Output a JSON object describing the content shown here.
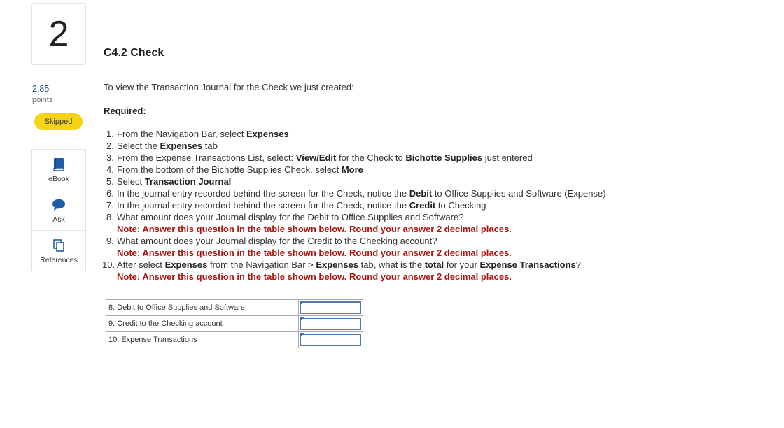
{
  "question_number": "2",
  "points": {
    "value": "2.85",
    "label": "points"
  },
  "status": "Skipped",
  "tools": [
    {
      "label": "eBook",
      "icon": "book-icon"
    },
    {
      "label": "Ask",
      "icon": "chat-bubble-icon"
    },
    {
      "label": "References",
      "icon": "copy-icon"
    }
  ],
  "title": "C4.2 Check",
  "intro": "To view the Transaction Journal for the Check we just created:",
  "required": "Required:",
  "steps": {
    "s1": {
      "n": "1.",
      "a": "From the Navigation Bar, select ",
      "b": "Expenses"
    },
    "s2": {
      "n": "2.",
      "a": "Select the ",
      "b": "Expenses",
      "c": " tab"
    },
    "s3": {
      "n": "3.",
      "a": "From the Expense Transactions List, select: ",
      "b": "View/Edit",
      "c": " for the Check to ",
      "d": "Bichotte Supplies",
      "e": " just entered"
    },
    "s4": {
      "n": "4.",
      "a": "From the bottom of the Bichotte Supplies Check, select ",
      "b": "More"
    },
    "s5": {
      "n": "5.",
      "a": "Select ",
      "b": "Transaction Journal"
    },
    "s6": {
      "n": "6.",
      "a": "In the journal entry recorded behind the screen for the Check, notice the ",
      "b": "Debit",
      "c": " to Office Supplies and Software (Expense)"
    },
    "s7": {
      "n": "7.",
      "a": "In the journal entry recorded behind the screen for the Check, notice the ",
      "b": "Credit",
      "c": " to Checking"
    },
    "s8": {
      "n": "8.",
      "a": "What amount does your Journal display for the Debit to Office Supplies and Software?",
      "note": "Note: Answer this question in the table shown below. Round your answer 2 decimal places."
    },
    "s9": {
      "n": "9.",
      "a": "What amount does your Journal display for the Credit to the Checking account?",
      "note": "Note: Answer this question in the table shown below. Round your answer 2 decimal places."
    },
    "s10": {
      "n": "10.",
      "a": "After select ",
      "b": "Expenses",
      "c": " from the Navigation Bar > ",
      "d": "Expenses",
      "e": " tab, what is the ",
      "f": "total",
      "g": " for your ",
      "h": "Expense Transactions",
      "i": "?",
      "note": "Note: Answer this question in the table shown below. Round your answer 2 decimal places."
    }
  },
  "answer_table": {
    "rows": [
      {
        "label": "8. Debit to Office Supplies and Software",
        "value": ""
      },
      {
        "label": "9. Credit to the Checking account",
        "value": ""
      },
      {
        "label": "10. Expense Transactions",
        "value": ""
      }
    ]
  },
  "colors": {
    "accent_blue": "#1c4f86",
    "badge_yellow": "#f5d415",
    "note_red": "#b0140f",
    "input_border": "#5579a8"
  }
}
